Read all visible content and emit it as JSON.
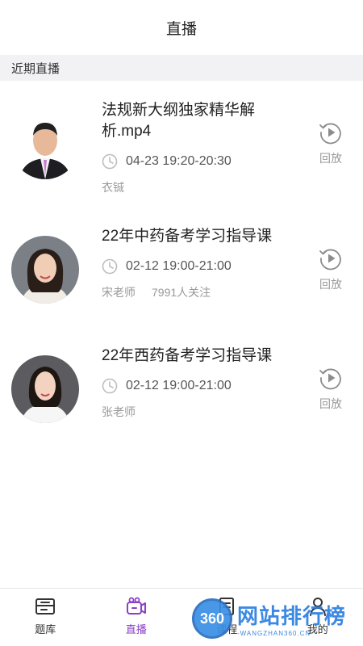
{
  "header": {
    "title": "直播"
  },
  "section": {
    "title": "近期直播"
  },
  "items": [
    {
      "title": "法规新大纲独家精华解析.mp4",
      "time": "04-23 19:20-20:30",
      "teacher": "衣铖",
      "followers": "",
      "replay_label": "回放",
      "avatar_icon": "teacher-photo-male"
    },
    {
      "title": "22年中药备考学习指导课",
      "time": "02-12 19:00-21:00",
      "teacher": "宋老师",
      "followers": "7991人关注",
      "replay_label": "回放",
      "avatar_icon": "teacher-photo-female"
    },
    {
      "title": "22年西药备考学习指导课",
      "time": "02-12 19:00-21:00",
      "teacher": "张老师",
      "followers": "",
      "replay_label": "回放",
      "avatar_icon": "teacher-photo-female"
    }
  ],
  "tabbar": {
    "tabs": [
      {
        "label": "题库",
        "icon": "question-bank-icon",
        "active": false
      },
      {
        "label": "直播",
        "icon": "live-camera-icon",
        "active": true
      },
      {
        "label": "课程",
        "icon": "course-book-icon",
        "active": false
      },
      {
        "label": "我的",
        "icon": "profile-icon",
        "active": false
      }
    ]
  },
  "watermark": {
    "badge": "360",
    "name": "网站排行榜",
    "url": "-WANGZHAN360.CN-"
  },
  "colors": {
    "accent": "#8a3fc4",
    "section_bg": "#f2f2f4",
    "muted": "#999999"
  }
}
